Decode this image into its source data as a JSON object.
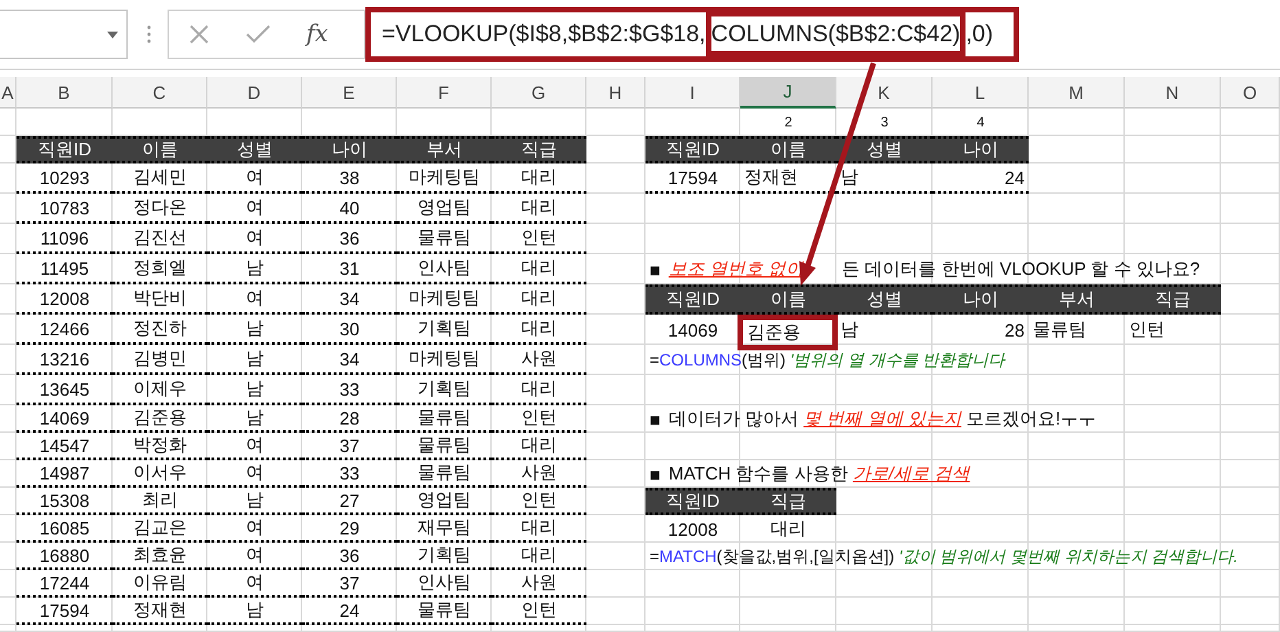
{
  "formula_bar": {
    "function_button": "fx",
    "formula": {
      "before": "=VLOOKUP($I$8,$B$2:$G$18,",
      "highlighted": "COLUMNS($B$2:C$42)",
      "after": ",0)"
    }
  },
  "column_headers": [
    {
      "label": "A",
      "selected": false
    },
    {
      "label": "B",
      "selected": false
    },
    {
      "label": "C",
      "selected": false
    },
    {
      "label": "D",
      "selected": false
    },
    {
      "label": "E",
      "selected": false
    },
    {
      "label": "F",
      "selected": false
    },
    {
      "label": "G",
      "selected": false
    },
    {
      "label": "H",
      "selected": false
    },
    {
      "label": "I",
      "selected": false
    },
    {
      "label": "J",
      "selected": true
    },
    {
      "label": "K",
      "selected": false
    },
    {
      "label": "L",
      "selected": false
    },
    {
      "label": "M",
      "selected": false
    },
    {
      "label": "N",
      "selected": false
    },
    {
      "label": "O",
      "selected": false
    }
  ],
  "column_numbers": [
    "2",
    "3",
    "4"
  ],
  "employee_table": {
    "columns": [
      "직원ID",
      "이름",
      "성별",
      "나이",
      "부서",
      "직급"
    ],
    "rows": [
      [
        "10293",
        "김세민",
        "여",
        "38",
        "마케팅팀",
        "대리"
      ],
      [
        "10783",
        "정다온",
        "여",
        "40",
        "영업팀",
        "대리"
      ],
      [
        "11096",
        "김진선",
        "여",
        "36",
        "물류팀",
        "인턴"
      ],
      [
        "11495",
        "정희엘",
        "남",
        "31",
        "인사팀",
        "대리"
      ],
      [
        "12008",
        "박단비",
        "여",
        "34",
        "마케팅팀",
        "대리"
      ],
      [
        "12466",
        "정진하",
        "남",
        "30",
        "기획팀",
        "대리"
      ],
      [
        "13216",
        "김병민",
        "남",
        "34",
        "마케팅팀",
        "사원"
      ],
      [
        "13645",
        "이제우",
        "남",
        "33",
        "기획팀",
        "대리"
      ],
      [
        "14069",
        "김준용",
        "남",
        "28",
        "물류팀",
        "인턴"
      ],
      [
        "14547",
        "박정화",
        "여",
        "37",
        "물류팀",
        "대리"
      ],
      [
        "14987",
        "이서우",
        "여",
        "33",
        "물류팀",
        "사원"
      ],
      [
        "15308",
        "최리",
        "남",
        "27",
        "영업팀",
        "인턴"
      ],
      [
        "16085",
        "김교은",
        "여",
        "29",
        "재무팀",
        "대리"
      ],
      [
        "16880",
        "최효윤",
        "여",
        "36",
        "기획팀",
        "대리"
      ],
      [
        "17244",
        "이유림",
        "여",
        "37",
        "인사팀",
        "사원"
      ],
      [
        "17594",
        "정재현",
        "남",
        "24",
        "물류팀",
        "인턴"
      ]
    ]
  },
  "lookup_table": {
    "columns": [
      "직원ID",
      "이름",
      "성별",
      "나이"
    ],
    "row": [
      "17594",
      "정재현",
      "남",
      "24"
    ]
  },
  "sections": [
    {
      "marker": "■",
      "emphasis": "보조 열번호 없이",
      "after": "든 데이터를 한번에 VLOOKUP 할 수 있나요?"
    },
    {
      "marker": "■",
      "before": "데이터가 많아서 ",
      "emphasis": "몇 번째 열에 있는지",
      "after": " 모르겠어요!ㅜㅜ"
    },
    {
      "marker": "■",
      "before": "MATCH 함수를 사용한 ",
      "emphasis": "가로/세로 검색"
    }
  ],
  "result_table": {
    "columns": [
      "직원ID",
      "이름",
      "성별",
      "나이",
      "부서",
      "직급"
    ],
    "row": [
      {
        "text": "14069",
        "highlighted": false
      },
      {
        "text": "김준용",
        "highlighted": true
      },
      {
        "text": "남",
        "highlighted": false
      },
      {
        "text": "28",
        "highlighted": false
      },
      {
        "text": "물류팀",
        "highlighted": false
      },
      {
        "text": "인턴",
        "highlighted": false
      }
    ]
  },
  "match_table": {
    "columns": [
      "직원ID",
      "직급"
    ],
    "row": [
      "12008",
      "대리"
    ]
  },
  "notes": [
    {
      "prefix": "=",
      "function": "COLUMNS",
      "args": "(범위)",
      "comment": "'범위의 열 개수를 반환합니다"
    },
    {
      "prefix": "=",
      "function": "MATCH",
      "args": "(찾을값,범위,[일치옵션])",
      "comment": "'값이 범위에서 몇번째 위치하는지 검색합니다."
    }
  ]
}
